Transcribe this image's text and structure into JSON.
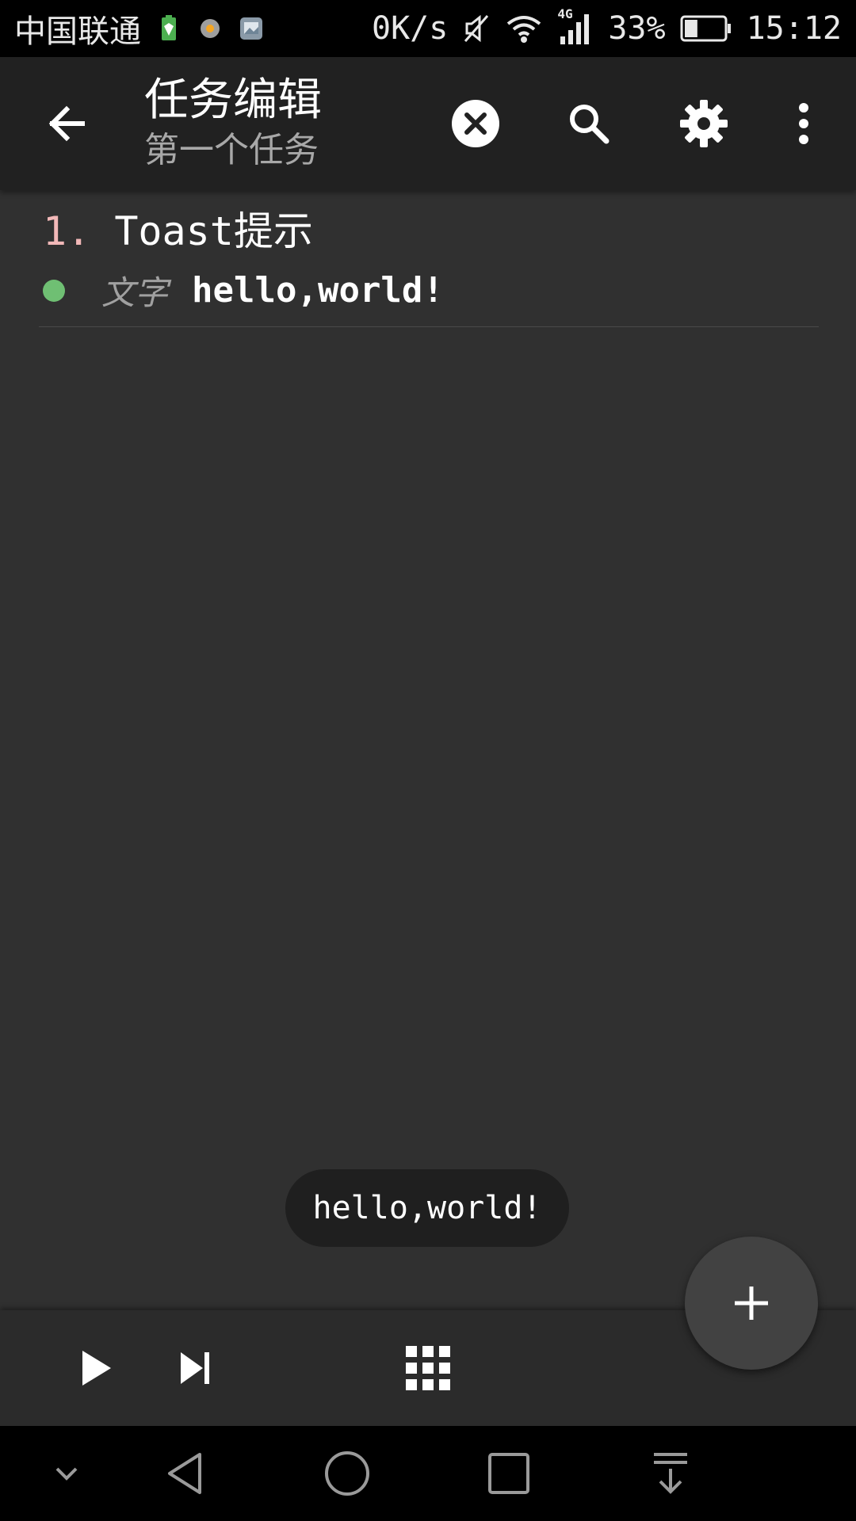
{
  "status_bar": {
    "carrier": "中国联通",
    "net_speed": "0K/s",
    "network_type": "4G",
    "battery_percent": "33%",
    "battery_level": 0.33,
    "time": "15:12",
    "icons": [
      "battery-saver-icon",
      "settings-app-icon",
      "gallery-app-icon",
      "mute-icon",
      "wifi-icon",
      "signal-icon",
      "battery-icon"
    ]
  },
  "toolbar": {
    "title": "任务编辑",
    "subtitle": "第一个任务",
    "icons": [
      "back-arrow-icon",
      "close-circle-icon",
      "search-icon",
      "gear-icon",
      "more-vert-icon"
    ]
  },
  "task_list": {
    "items": [
      {
        "index": "1.",
        "name": "Toast提示",
        "status_color": "#6fbf73",
        "field_label": "文字",
        "field_value": "hello,world!"
      }
    ]
  },
  "toast": {
    "message": "hello,world!"
  },
  "bottom_bar": {
    "icons": [
      "play-icon",
      "skip-next-icon",
      "grid-icon"
    ]
  },
  "fab": {
    "icon": "plus-icon"
  },
  "nav_bar": {
    "icons": [
      "chevron-down-icon",
      "back-triangle-icon",
      "home-circle-icon",
      "recents-square-icon",
      "pull-down-icon"
    ]
  },
  "colors": {
    "background": "#303030",
    "toolbar": "#212121",
    "accent_number": "#f2b8b8",
    "status_dot": "#6fbf73"
  }
}
